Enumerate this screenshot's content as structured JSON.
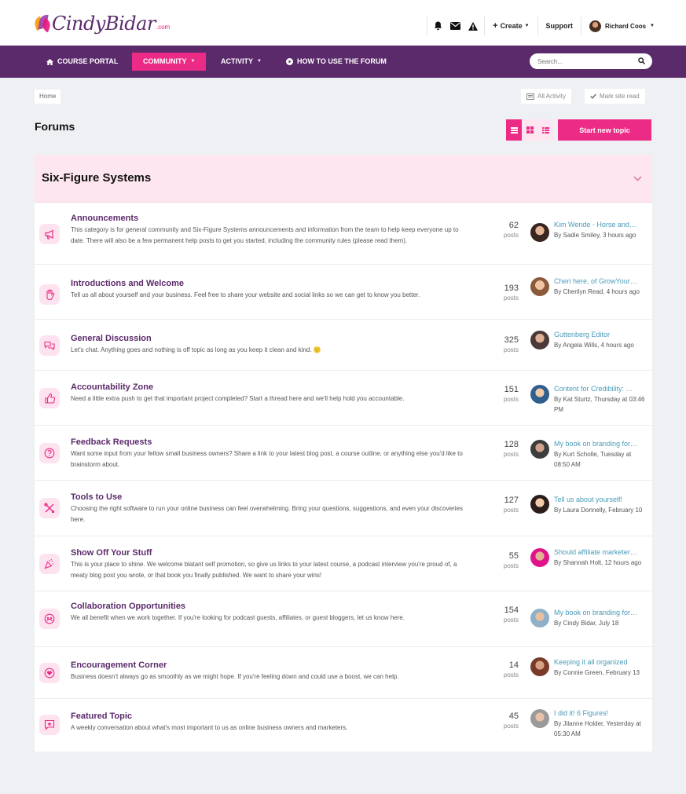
{
  "header": {
    "logo_name": "CindyBidar",
    "logo_suffix": ".com",
    "create_label": "Create",
    "support_label": "Support",
    "user_name": "Richard Coos"
  },
  "nav": {
    "items": [
      {
        "label": "COURSE PORTAL",
        "icon": "home-icon"
      },
      {
        "label": "COMMUNITY",
        "icon": "chevron-down-icon",
        "active": true
      },
      {
        "label": "ACTIVITY",
        "icon": "chevron-down-icon"
      },
      {
        "label": "HOW TO USE THE FORUM",
        "icon": "play-circle-icon"
      }
    ],
    "search_placeholder": "Search..."
  },
  "breadcrumb": {
    "home": "Home"
  },
  "actions": {
    "all_activity": "All Activity",
    "mark_read": "Mark site read"
  },
  "page_title": "Forums",
  "start_topic": "Start new topic",
  "category": {
    "title": "Six-Figure Systems",
    "forums": [
      {
        "title": "Announcements",
        "desc": "This category is for general community and Six-Figure Systems announcements and information from the team to help keep everyone up to date. There will also be a few permanent help posts to get you started, including the community rules (please read them).",
        "count": "62",
        "posts_label": "posts",
        "last_title": "Kim Wende - Horse and…",
        "last_by": "By Sadie Smiley, 3 hours ago",
        "icon": "megaphone-icon"
      },
      {
        "title": "Introductions and Welcome",
        "desc": "Tell us all about yourself and your business. Feel free to share your website and social links so we can get to know you better.",
        "count": "193",
        "posts_label": "posts",
        "last_title": "Cheri here, of GrowYour…",
        "last_by": "By Cherilyn Read, 4 hours ago",
        "icon": "wave-hand-icon"
      },
      {
        "title": "General Discussion",
        "desc": "Let's chat. Anything goes and nothing is off topic as long as you keep it clean and kind. 🙂",
        "count": "325",
        "posts_label": "posts",
        "last_title": "Guttenberg Editor",
        "last_by": "By Angela Wills, 4 hours ago",
        "icon": "chat-bubbles-icon"
      },
      {
        "title": "Accountability Zone",
        "desc": "Need a little extra push to get that important project completed? Start a thread here and we'll help hold you accountable.",
        "count": "151",
        "posts_label": "posts",
        "last_title": "Content for Credibility: …",
        "last_by": "By Kat Sturtz, Thursday at 03:46 PM",
        "icon": "thumbs-up-icon"
      },
      {
        "title": "Feedback Requests",
        "desc": "Want some input from your fellow small business owners? Share a link to your latest blog post, a course outline, or anything else you'd like to brainstorm about.",
        "count": "128",
        "posts_label": "posts",
        "last_title": "My book on branding for…",
        "last_by": "By Kurt Scholle, Tuesday at 08:50 AM",
        "icon": "question-circle-icon"
      },
      {
        "title": "Tools to Use",
        "desc": "Choosing the right software to run your online business can feel overwhelming. Bring your questions, suggestions, and even your discoveries here.",
        "count": "127",
        "posts_label": "posts",
        "last_title": "Tell us about yourself!",
        "last_by": "By Laura Donnelly, February 10",
        "icon": "tools-icon"
      },
      {
        "title": "Show Off Your Stuff",
        "desc": "This is your place to shine. We welcome blatant self promotion, so give us links to your latest course, a podcast interview you're proud of, a meaty blog post you wrote, or that book you finally published. We want to share your wins!",
        "count": "55",
        "posts_label": "posts",
        "last_title": "Should affiliate marketer…",
        "last_by": "By Shannah Holt, 12 hours ago",
        "icon": "party-popper-icon"
      },
      {
        "title": "Collaboration Opportunities",
        "desc": "We all benefit when we work together. If you're looking for podcast guests, affiliates, or guest bloggers, let us know here.",
        "count": "154",
        "posts_label": "posts",
        "last_title": "My book on branding for…",
        "last_by": "By Cindy Bidar, July 18",
        "icon": "group-icon"
      },
      {
        "title": "Encouragement Corner",
        "desc": "Business doesn't always go as smoothly as we might hope. If you're feeling down and could use a boost, we can help.",
        "count": "14",
        "posts_label": "posts",
        "last_title": "Keeping it all organized",
        "last_by": "By Connie Green, February 13",
        "icon": "heart-circle-icon"
      },
      {
        "title": "Featured Topic",
        "desc": "A weekly conversation about what's most important to us as online business owners and marketers.",
        "count": "45",
        "posts_label": "posts",
        "last_title": "I did it! 6 Figures!",
        "last_by": "By Jilanne Holder, Yesterday at 05:30 AM",
        "icon": "star-message-icon"
      }
    ]
  },
  "colors": {
    "brand_purple": "#5b2a6b",
    "brand_pink": "#ec2b86",
    "link_blue": "#4a9bb8"
  }
}
